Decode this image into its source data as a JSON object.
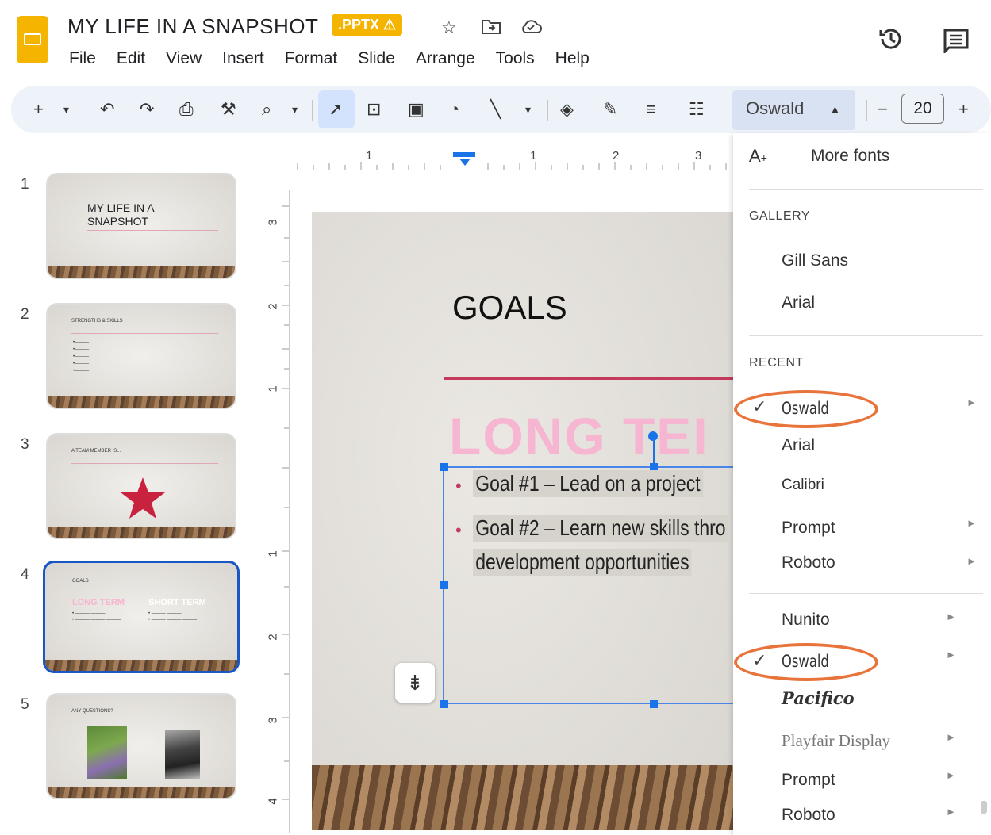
{
  "header": {
    "title": "MY LIFE IN A SNAPSHOT",
    "badge": ".PPTX ⚠",
    "menu": [
      "File",
      "Edit",
      "View",
      "Insert",
      "Format",
      "Slide",
      "Arrange",
      "Tools",
      "Help"
    ]
  },
  "toolbar": {
    "font_name": "Oswald",
    "font_size": "20"
  },
  "ruler": {
    "h_ticks": [
      "1",
      "1",
      "2",
      "3"
    ],
    "v_ticks": [
      "3",
      "2",
      "1",
      "1",
      "2",
      "3",
      "4"
    ]
  },
  "thumbnails": [
    {
      "num": "1",
      "title": "MY LIFE IN A SNAPSHOT"
    },
    {
      "num": "2",
      "title": "STRENGTHS & SKILLS"
    },
    {
      "num": "3",
      "title": "A TEAM MEMBER IS..."
    },
    {
      "num": "4",
      "title": "GOALS",
      "sub_a": "LONG TERM",
      "sub_b": "SHORT TERM"
    },
    {
      "num": "5",
      "title": "ANY QUESTIONS?"
    }
  ],
  "slide": {
    "title": "GOALS",
    "heading": "LONG TEI",
    "bullets": [
      "Goal #1 – Lead on a project",
      "Goal #2 – Learn new skills thro",
      "development opportunities"
    ]
  },
  "font_menu": {
    "more_fonts": "More fonts",
    "gallery_head": "GALLERY",
    "gallery": [
      "Gill Sans",
      "Arial"
    ],
    "recent_head": "RECENT",
    "recent": [
      "Oswald",
      "Arial",
      "Calibri",
      "Prompt",
      "Roboto"
    ],
    "list": [
      "Nunito",
      "Oswald",
      "Pacifico",
      "Playfair Display",
      "Prompt",
      "Roboto"
    ]
  },
  "colors": {
    "accent_orange": "#e8743b",
    "selection_blue": "#1a73e8",
    "pink": "#f6b5d0",
    "rule_red": "#c43a5d",
    "slides_yellow": "#f4b400"
  }
}
